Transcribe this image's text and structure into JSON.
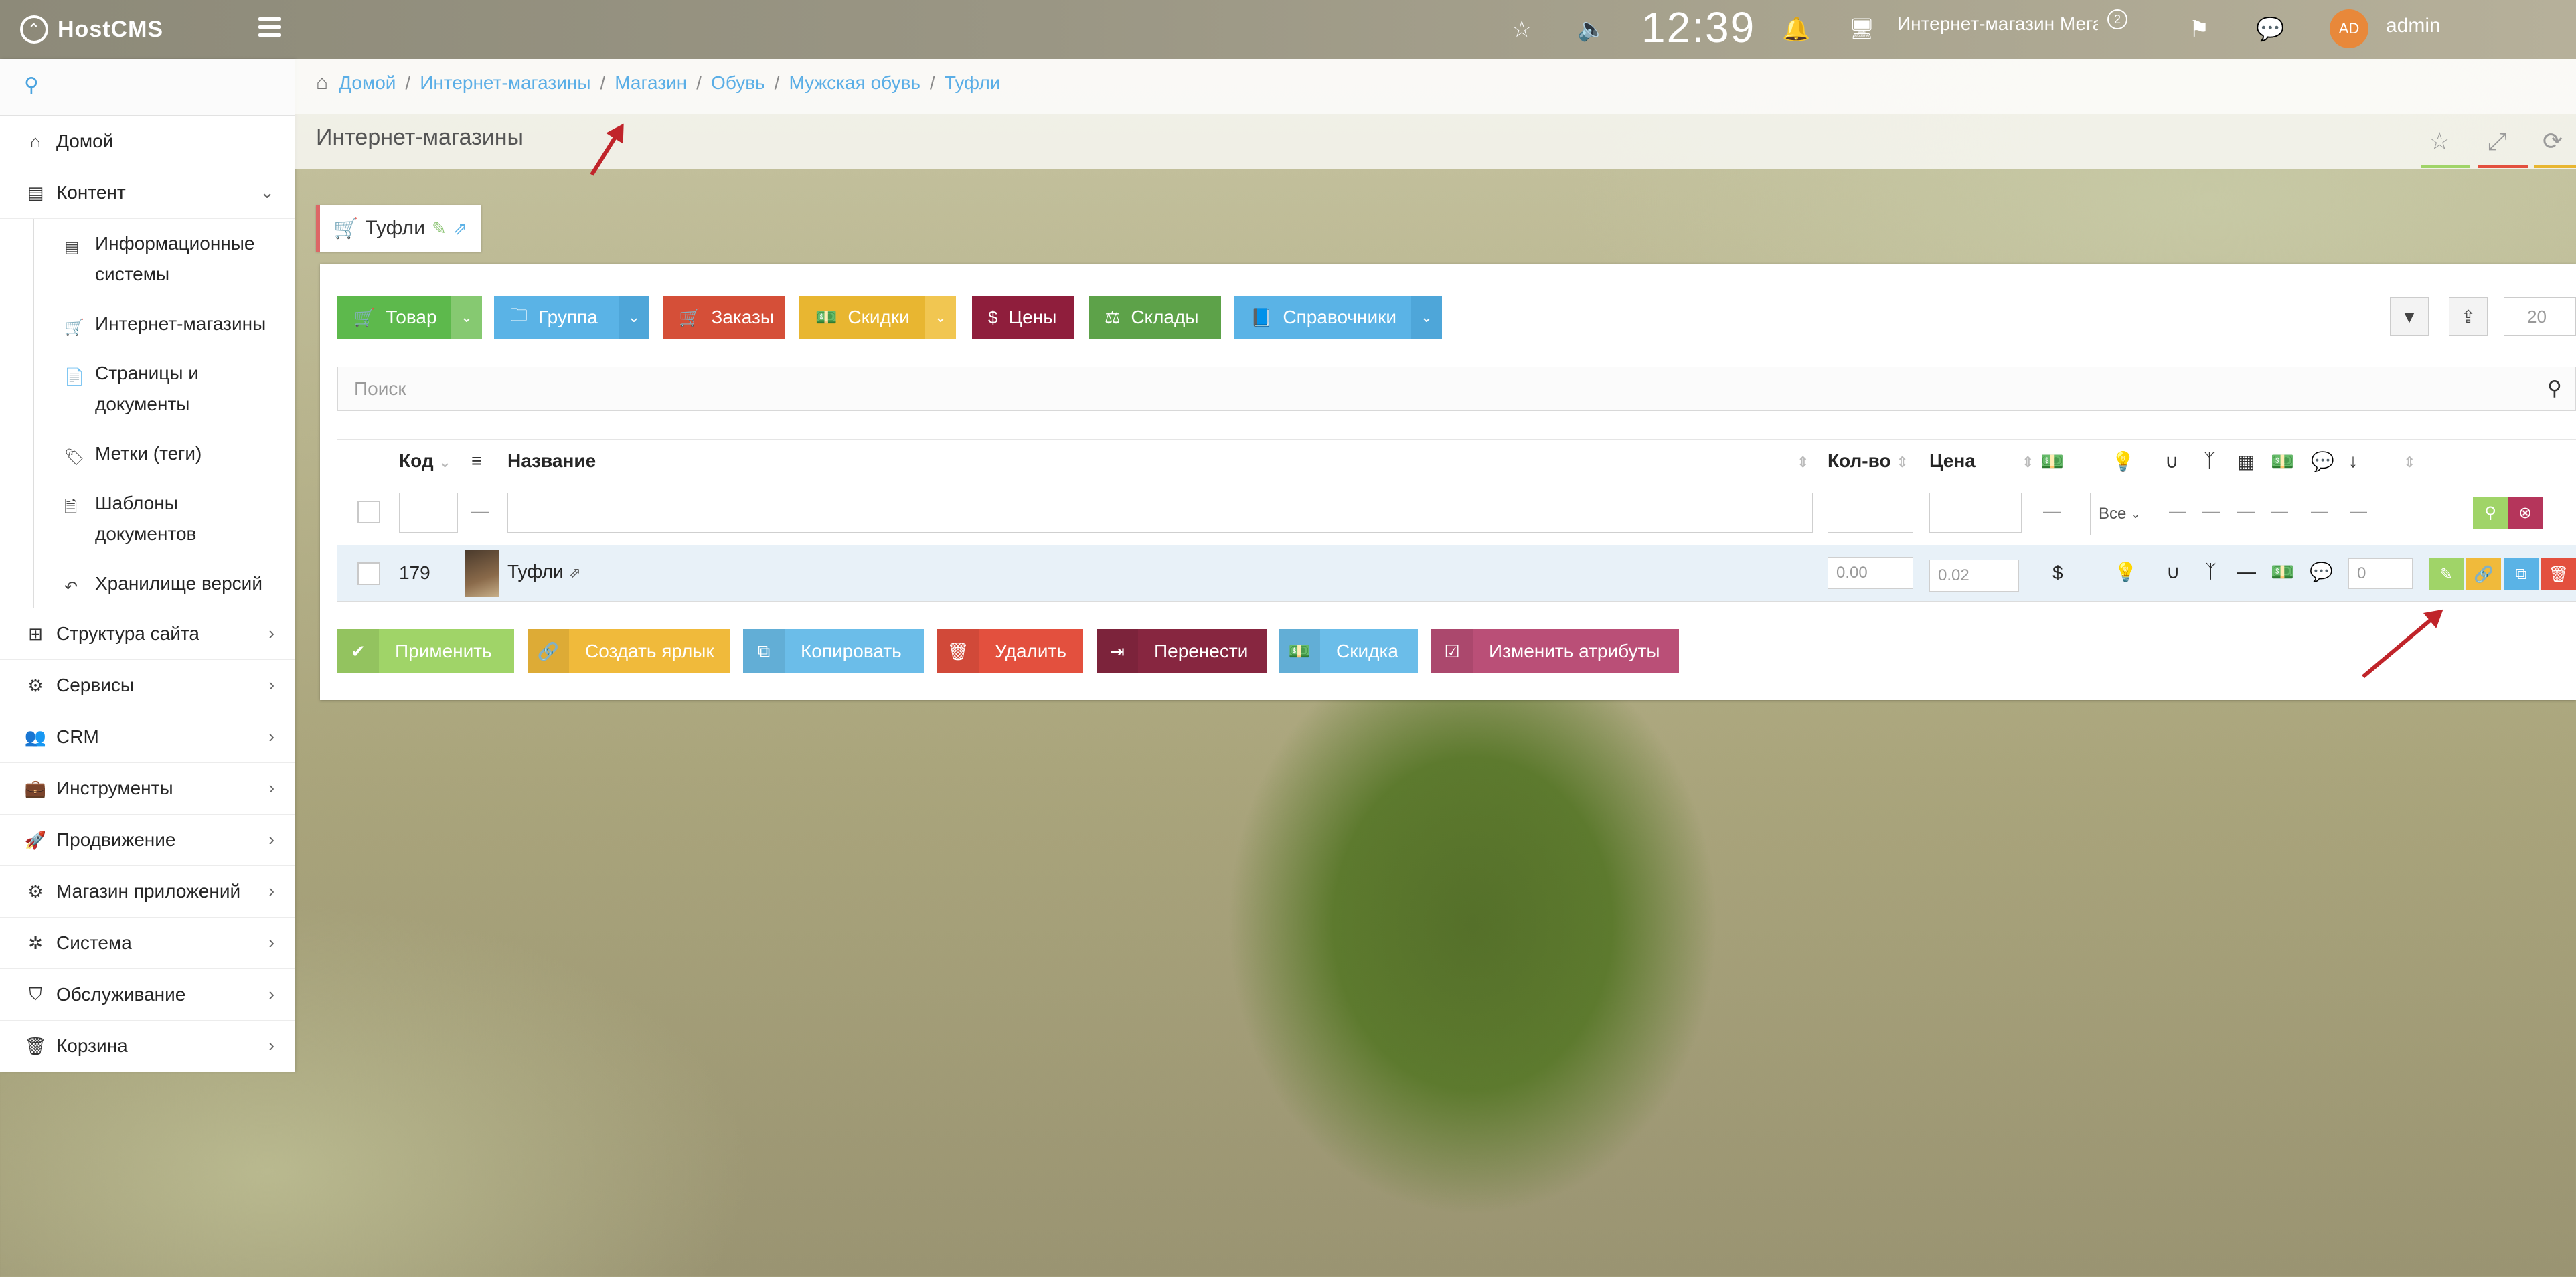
{
  "app": {
    "logo_text": "HostCMS"
  },
  "navbar": {
    "clock": "12:39",
    "site_name": "Интернет-магазин Мега",
    "notifications_badge": "2",
    "avatar_initials": "AD",
    "user_name": "admin"
  },
  "sidebar": {
    "items": [
      {
        "label": "Домой",
        "icon": "home-icon"
      },
      {
        "label": "Контент",
        "icon": "newspaper-icon"
      },
      {
        "label": "Структура сайта",
        "icon": "sitemap-icon"
      },
      {
        "label": "Сервисы",
        "icon": "cogs-icon"
      },
      {
        "label": "CRM",
        "icon": "users-icon"
      },
      {
        "label": "Инструменты",
        "icon": "briefcase-icon"
      },
      {
        "label": "Продвижение",
        "icon": "rocket-icon"
      },
      {
        "label": "Магазин приложений",
        "icon": "puzzle-icon"
      },
      {
        "label": "Система",
        "icon": "gear-icon"
      },
      {
        "label": "Обслуживание",
        "icon": "shield-icon"
      },
      {
        "label": "Корзина",
        "icon": "trash-icon"
      }
    ],
    "content_sub": [
      {
        "label_1": "Информационные",
        "label_2": "системы"
      },
      {
        "label_1": "Интернет-магазины",
        "label_2": ""
      },
      {
        "label_1": "Страницы и",
        "label_2": "документы"
      },
      {
        "label_1": "Метки (теги)",
        "label_2": ""
      },
      {
        "label_1": "Шаблоны",
        "label_2": "документов"
      },
      {
        "label_1": "Хранилище версий",
        "label_2": ""
      }
    ]
  },
  "breadcrumbs": [
    "Домой",
    "Интернет-магазины",
    "Магазин",
    "Обувь",
    "Мужская обувь",
    "Туфли"
  ],
  "page_title": "Интернет-магазины",
  "tab": {
    "label": "Туфли"
  },
  "toolbar": {
    "product": "Товар",
    "group": "Группа",
    "orders": "Заказы",
    "discounts": "Скидки",
    "prices": "Цены",
    "warehouses": "Склады",
    "reference": "Справочники",
    "page_size": "20"
  },
  "search": {
    "placeholder": "Поиск"
  },
  "table": {
    "columns": {
      "code": "Код",
      "name": "Название",
      "qty": "Кол-во",
      "price": "Цена"
    },
    "filter": {
      "select_value": "Все"
    },
    "rows": [
      {
        "code": "179",
        "name": "Туфли",
        "qty": "0.00",
        "price": "0.02",
        "currency": "$",
        "sort": "0"
      }
    ]
  },
  "actions": {
    "apply": "Применить",
    "shortcut": "Создать ярлык",
    "copy": "Копировать",
    "delete": "Удалить",
    "move": "Перенести",
    "discount": "Скидка",
    "attributes": "Изменить атрибуты"
  },
  "colors": {
    "green": "#5db94c",
    "blue": "#5ab3e6",
    "red": "#d54f38",
    "yellow": "#e8b631",
    "maroon": "#8f1e3c",
    "darkgreen": "#5da249",
    "lightgreen": "#a0d468",
    "orange": "#f0ba3b",
    "lightblue": "#6bbde9",
    "brightred": "#e3503e",
    "darkmaroon": "#872640",
    "rose": "#ba4f77"
  }
}
